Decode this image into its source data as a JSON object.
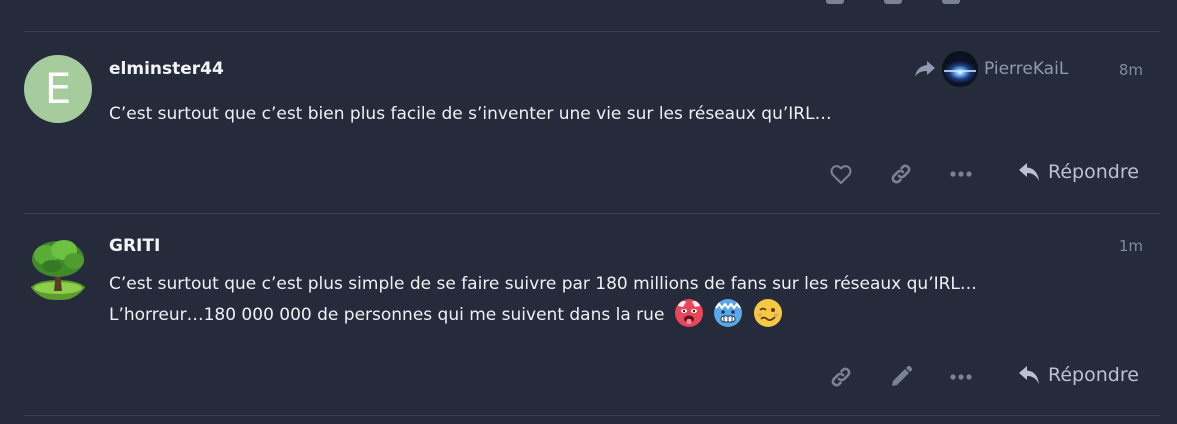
{
  "posts": [
    {
      "username": "elminster44",
      "avatar_letter": "E",
      "timestamp": "8m",
      "reply_to": "PierreKaiL",
      "lines": [
        "C’est surtout que c’est bien plus facile de s’inventer une vie sur les réseaux qu’IRL…"
      ],
      "reply_label": "Répondre",
      "actions": [
        "heart-icon",
        "link-icon",
        "more-icon"
      ]
    },
    {
      "username": "GRITI",
      "timestamp": "1m",
      "lines": [
        "C’est surtout que c’est plus simple de se faire suivre par 180 millions de fans sur les réseaux qu’IRL…",
        "L’horreur…180 000 000 de personnes qui me suivent dans la rue"
      ],
      "emojis": [
        "hot-face-emoji",
        "cold-face-emoji",
        "woozy-face-emoji"
      ],
      "reply_label": "Répondre",
      "actions": [
        "link-icon",
        "pencil-icon",
        "more-icon"
      ]
    }
  ],
  "colors": {
    "background": "#262b3c",
    "divider": "#3a4052",
    "icon": "#7b8296",
    "muted_text": "#7f8aa3",
    "avatar_bg": "#a6cb9c"
  }
}
